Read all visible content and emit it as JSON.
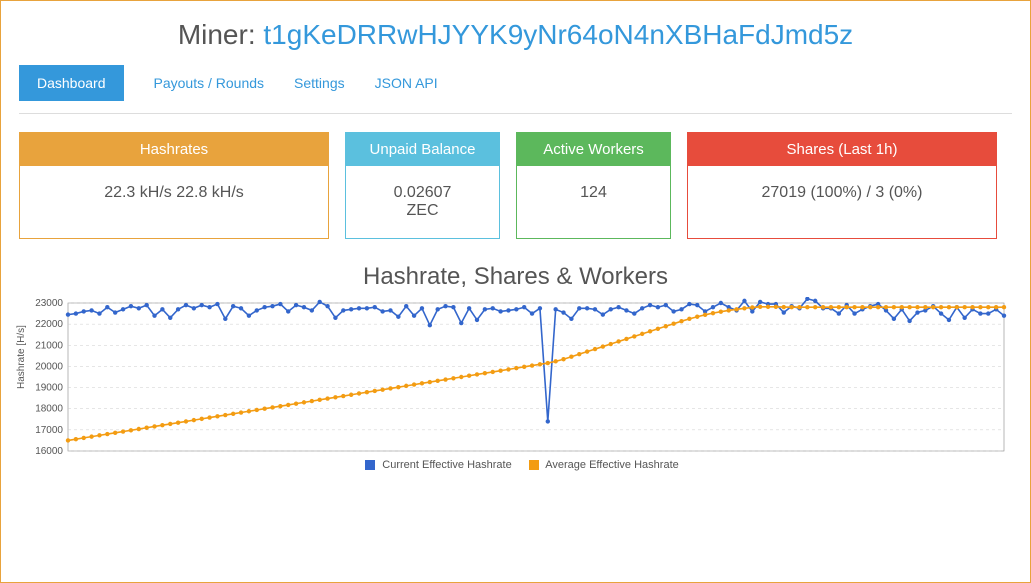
{
  "header": {
    "prefix": "Miner: ",
    "address": "t1gKeDRRwHJYYK9yNr64oN4nXBHaFdJmd5z"
  },
  "tabs": {
    "dashboard": "Dashboard",
    "payouts": "Payouts / Rounds",
    "settings": "Settings",
    "json_api": "JSON API"
  },
  "cards": {
    "hashrates": {
      "title": "Hashrates",
      "line1": "22.3 kH/s   22.8 kH/s"
    },
    "unpaid": {
      "title": "Unpaid Balance",
      "line1": "0.02607",
      "line2": "ZEC"
    },
    "workers": {
      "title": "Active Workers",
      "line1": "124"
    },
    "shares": {
      "title": "Shares (Last 1h)",
      "line1": "27019 (100%) / 3 (0%)"
    }
  },
  "chart": {
    "title": "Hashrate, Shares & Workers",
    "ylabel": "Hashrate [H/s]",
    "legend": {
      "current": "Current Effective Hashrate",
      "average": "Average Effective Hashrate"
    }
  },
  "chart_data": {
    "type": "line",
    "ylabel": "Hashrate [H/s]",
    "ylim": [
      16000,
      23000
    ],
    "yticks": [
      16000,
      17000,
      18000,
      19000,
      20000,
      21000,
      22000,
      23000
    ],
    "series": [
      {
        "name": "Current Effective Hashrate",
        "color": "#3366cc",
        "values": [
          22450,
          22500,
          22600,
          22650,
          22500,
          22800,
          22550,
          22700,
          22850,
          22750,
          22900,
          22400,
          22700,
          22300,
          22700,
          22900,
          22750,
          22900,
          22800,
          22950,
          22250,
          22850,
          22750,
          22400,
          22650,
          22800,
          22850,
          22950,
          22600,
          22900,
          22800,
          22650,
          23050,
          22850,
          22300,
          22650,
          22700,
          22750,
          22750,
          22800,
          22600,
          22650,
          22350,
          22850,
          22400,
          22750,
          21950,
          22700,
          22850,
          22800,
          22050,
          22750,
          22200,
          22700,
          22750,
          22600,
          22650,
          22700,
          22800,
          22500,
          22750,
          17400,
          22700,
          22550,
          22250,
          22750,
          22750,
          22700,
          22450,
          22700,
          22800,
          22650,
          22500,
          22750,
          22900,
          22800,
          22900,
          22600,
          22700,
          22950,
          22900,
          22600,
          22800,
          23000,
          22800,
          22650,
          23100,
          22600,
          23050,
          22950,
          22950,
          22550,
          22850,
          22750,
          23200,
          23100,
          22750,
          22750,
          22500,
          22900,
          22500,
          22700,
          22850,
          22950,
          22650,
          22250,
          22700,
          22150,
          22550,
          22650,
          22850,
          22500,
          22200,
          22800,
          22300,
          22700,
          22500,
          22500,
          22700,
          22400
        ]
      },
      {
        "name": "Average Effective Hashrate",
        "color": "#f39c12",
        "values": [
          16500,
          16560,
          16620,
          16680,
          16740,
          16800,
          16860,
          16920,
          16980,
          17040,
          17100,
          17160,
          17220,
          17280,
          17340,
          17400,
          17460,
          17520,
          17580,
          17640,
          17700,
          17760,
          17820,
          17880,
          17940,
          18000,
          18060,
          18120,
          18180,
          18240,
          18300,
          18360,
          18420,
          18480,
          18540,
          18600,
          18660,
          18720,
          18780,
          18840,
          18900,
          18960,
          19020,
          19080,
          19140,
          19200,
          19260,
          19320,
          19380,
          19440,
          19500,
          19560,
          19620,
          19680,
          19740,
          19800,
          19860,
          19920,
          19980,
          20040,
          20100,
          20160,
          20240,
          20340,
          20460,
          20580,
          20700,
          20820,
          20940,
          21060,
          21180,
          21300,
          21420,
          21540,
          21660,
          21780,
          21900,
          22020,
          22140,
          22250,
          22350,
          22440,
          22520,
          22590,
          22650,
          22700,
          22750,
          22790,
          22820,
          22820,
          22820,
          22810,
          22800,
          22800,
          22800,
          22800,
          22800,
          22800,
          22800,
          22800,
          22800,
          22800,
          22800,
          22800,
          22800,
          22800,
          22800,
          22800,
          22800,
          22800,
          22800,
          22800,
          22800,
          22800,
          22800,
          22800,
          22800,
          22800,
          22800,
          22800
        ]
      }
    ]
  }
}
